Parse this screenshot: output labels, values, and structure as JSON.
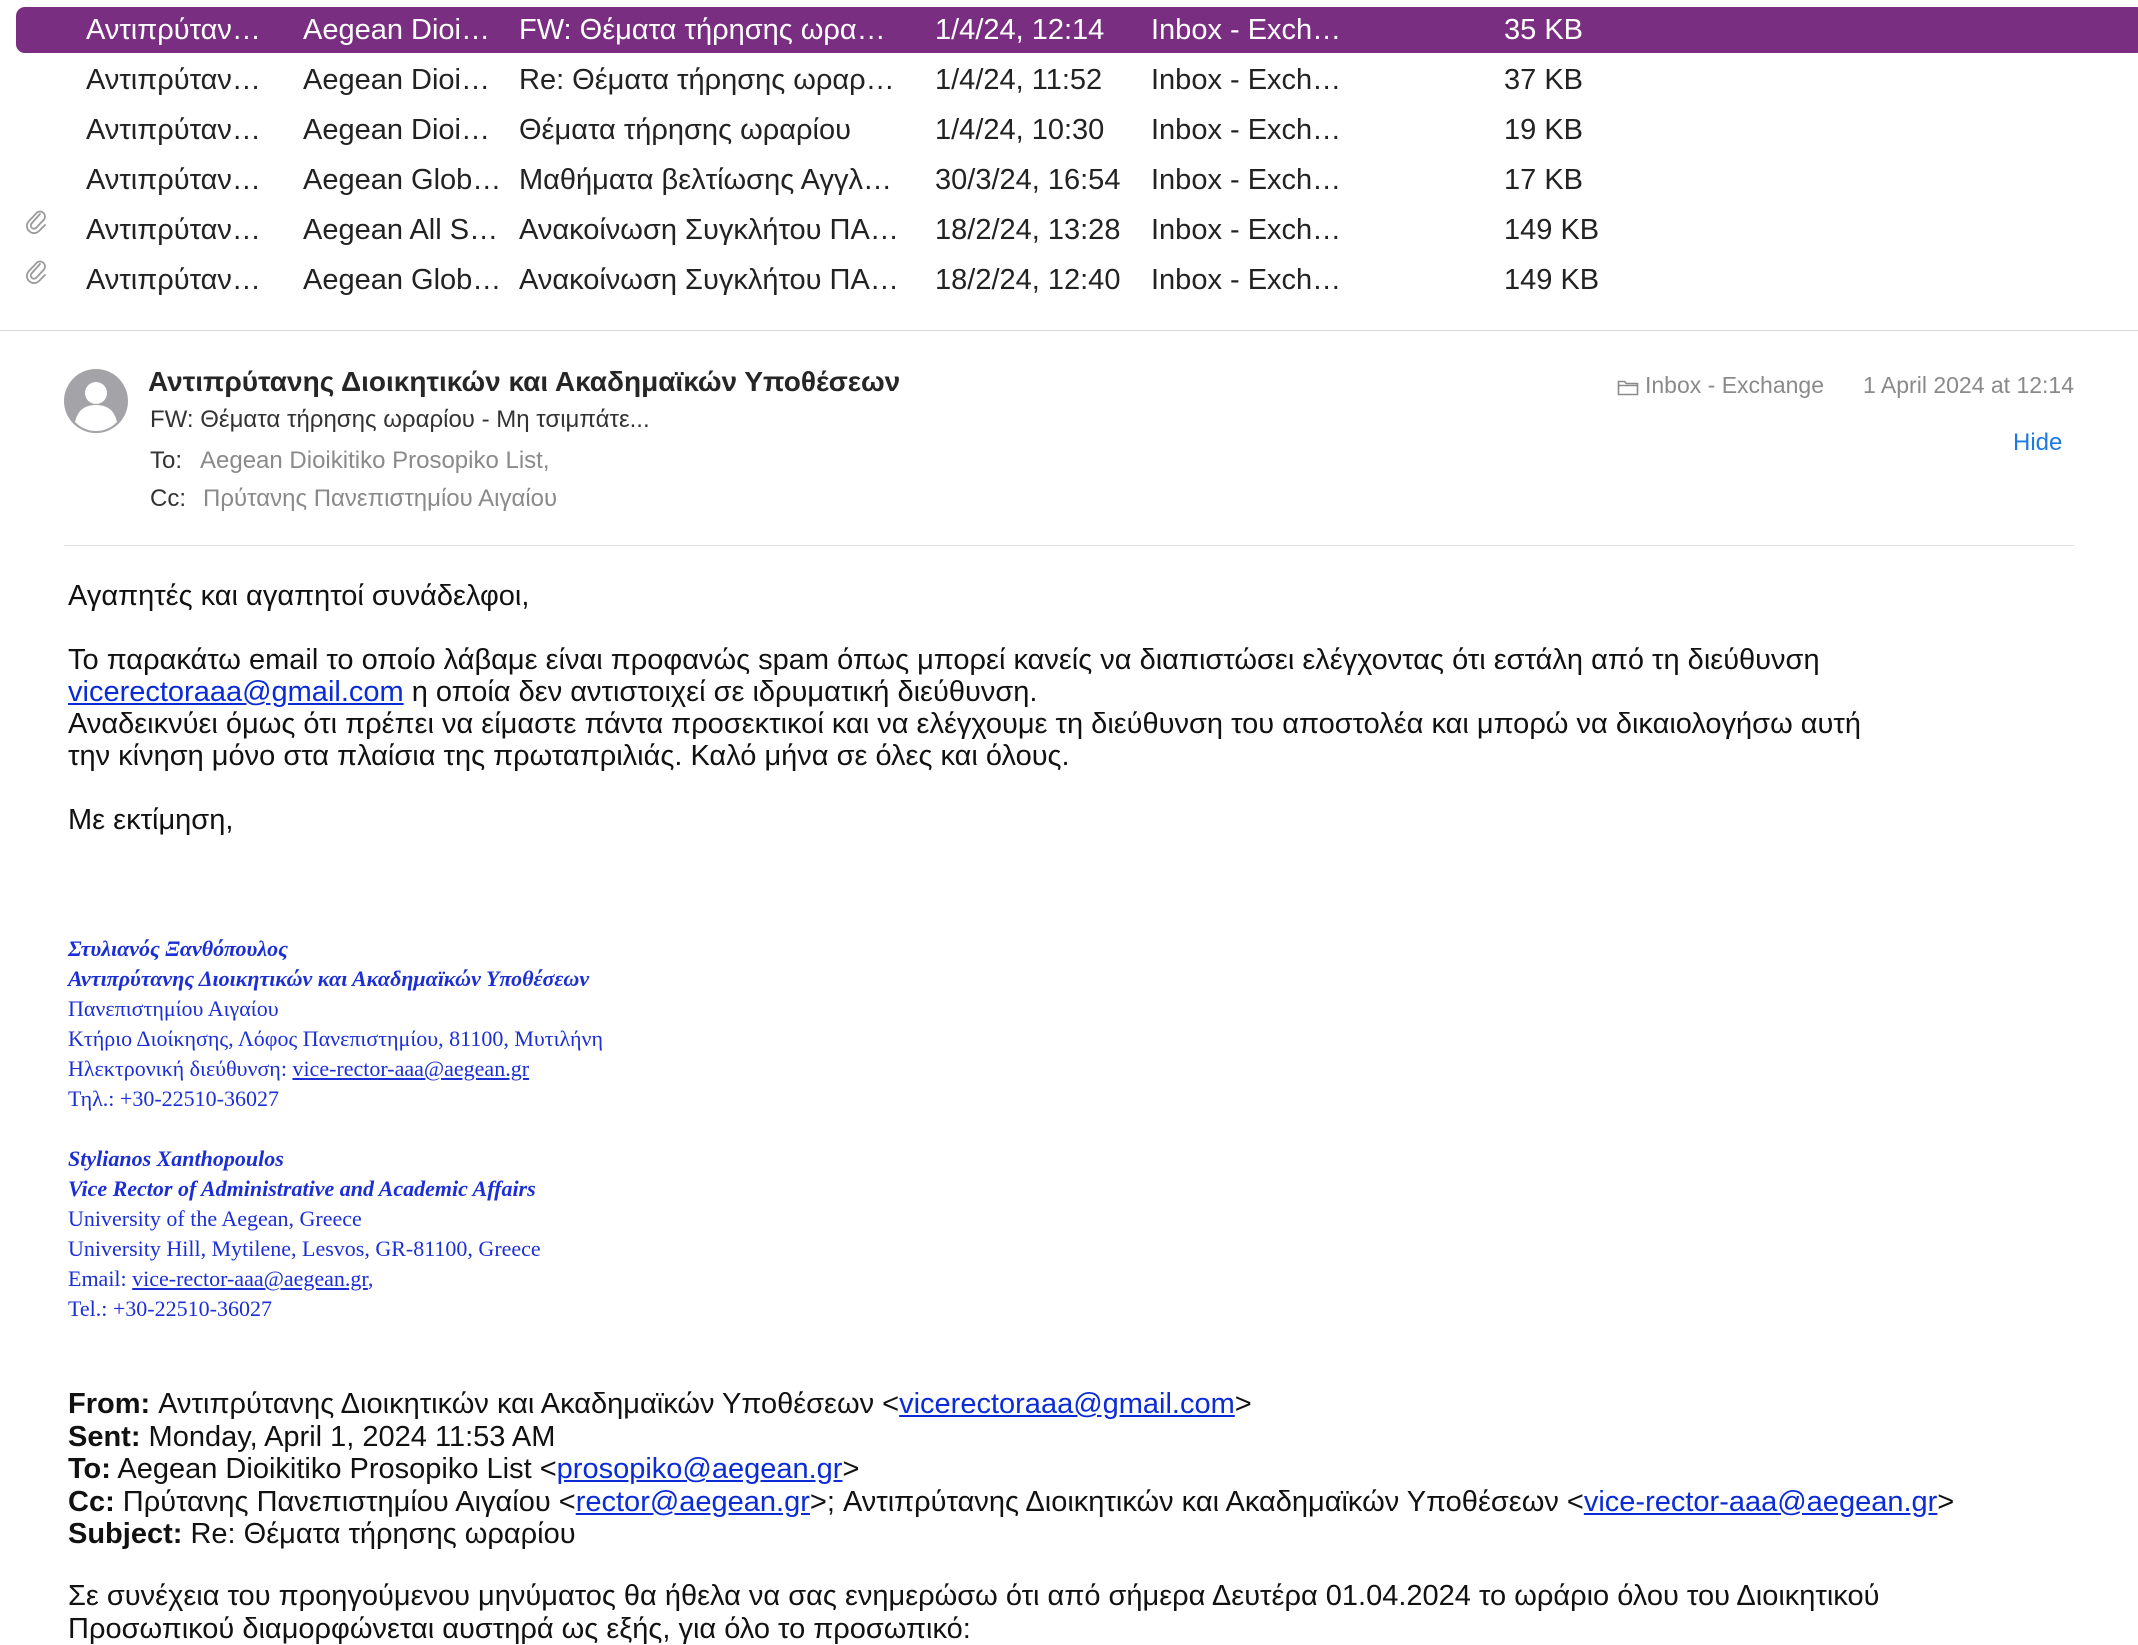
{
  "colors": {
    "selection": "#7a2e81",
    "link": "#0a2bd6",
    "signature": "#1b2fd4",
    "hide_link": "#1f7ae0"
  },
  "list": {
    "rows": [
      {
        "from": "Αντιπρύταν…",
        "to": "Aegean Dioi…",
        "subject": "FW: Θέματα τήρησης ωρα…",
        "date": "1/4/24, 12:14",
        "mailbox": "Inbox - Exch…",
        "size": "35 KB",
        "attachment": false,
        "selected": true
      },
      {
        "from": "Αντιπρύταν…",
        "to": "Aegean Dioi…",
        "subject": "Re: Θέματα τήρησης ωραρ…",
        "date": "1/4/24, 11:52",
        "mailbox": "Inbox - Exch…",
        "size": "37 KB",
        "attachment": false,
        "selected": false
      },
      {
        "from": "Αντιπρύταν…",
        "to": "Aegean Dioi…",
        "subject": "Θέματα τήρησης ωραρίου",
        "date": "1/4/24, 10:30",
        "mailbox": "Inbox - Exch…",
        "size": "19 KB",
        "attachment": false,
        "selected": false
      },
      {
        "from": "Αντιπρύταν…",
        "to": "Aegean Glob…",
        "subject": "Μαθήματα βελτίωσης Αγγλ…",
        "date": "30/3/24, 16:54",
        "mailbox": "Inbox - Exch…",
        "size": "17 KB",
        "attachment": false,
        "selected": false
      },
      {
        "from": "Αντιπρύταν…",
        "to": "Aegean All S…",
        "subject": "Ανακοίνωση Συγκλήτου ΠΑ…",
        "date": "18/2/24, 13:28",
        "mailbox": "Inbox - Exch…",
        "size": "149 KB",
        "attachment": true,
        "selected": false
      },
      {
        "from": "Αντιπρύταν…",
        "to": "Aegean Glob…",
        "subject": "Ανακοίνωση Συγκλήτου ΠΑ…",
        "date": "18/2/24, 12:40",
        "mailbox": "Inbox - Exch…",
        "size": "149 KB",
        "attachment": true,
        "selected": false
      }
    ]
  },
  "header": {
    "sender": "Αντιπρύτανης Διοικητικών και Ακαδημαϊκών Υποθέσεων",
    "subject": "FW: Θέματα τήρησης ωραρίου - Μη τσιμπάτε...",
    "to_label": "To:",
    "to_value": "Aegean Dioikitiko Prosopiko List,",
    "cc_label": "Cc:",
    "cc_value": "Πρύτανης Πανεπιστημίου Αιγαίου",
    "mailbox": "Inbox - Exchange",
    "date": "1 April 2024 at 12:14",
    "hide": "Hide"
  },
  "body": {
    "greeting": "Αγαπητές και αγαπητοί συνάδελφοι,",
    "p1_a": "Το παρακάτω email το οποίο λάβαμε είναι προφανώς spam όπως μπορεί κανείς να διαπιστώσει ελέγχοντας ότι εστάλη από τη διεύθυνση",
    "p1_link": "vicerectoraaa@gmail.com",
    "p1_b": " η οποία δεν αντιστοιχεί σε ιδρυματική διεύθυνση.",
    "p2_line1": "Αναδεικνύει όμως ότι πρέπει να είμαστε πάντα προσεκτικοί και να ελέγχουμε τη διεύθυνση του αποστολέα  και μπορώ να δικαιολογήσω αυτή",
    "p2_line2": "την κίνηση μόνο στα πλαίσια της πρωταπριλιάς. Καλό μήνα σε όλες και όλους.",
    "closing": "Με εκτίμηση,"
  },
  "signature": {
    "gr_name": "Στυλιανός Ξανθόπουλος",
    "gr_title": "Αντιπρύτανης Διοικητικών και Ακαδημαϊκών Υποθέσεων",
    "gr_univ": "Πανεπιστημίου Αιγαίου",
    "gr_address": "Κτήριο Διοίκησης, Λόφος Πανεπιστημίου, 81100, Μυτιλήνη",
    "gr_email_label": "Ηλεκτρονική διεύθυνση: ",
    "gr_email": "vice-rector-aaa@aegean.gr",
    "gr_phone": "Τηλ.: +30-22510-36027",
    "en_name": "Stylianos Xanthopoulos",
    "en_title": "Vice Rector of Administrative and Academic Affairs",
    "en_univ": "University of the Aegean, Greece",
    "en_address": "University Hill, Mytilene, Lesvos, GR-81100, Greece",
    "en_email_label": "Email: ",
    "en_email": "vice-rector-aaa@aegean.gr",
    "en_email_suffix": ",",
    "en_phone": "Tel.: +30-22510-36027"
  },
  "forwarded": {
    "from_label": "From:",
    "from_name": " Αντιπρύτανης Διοικητικών και Ακαδημαϊκών Υποθέσεων <",
    "from_email": "vicerectoraaa@gmail.com",
    "from_end": ">",
    "sent_label": "Sent:",
    "sent_value": " Monday, April 1, 2024 11:53 AM",
    "to_label": "To:",
    "to_name": " Aegean Dioikitiko Prosopiko List <",
    "to_email": "prosopiko@aegean.gr",
    "to_end": ">",
    "cc_label": "Cc:",
    "cc_name1": " Πρύτανης Πανεπιστημίου Αιγαίου <",
    "cc_email1": "rector@aegean.gr",
    "cc_mid": ">; Αντιπρύτανης Διοικητικών και Ακαδημαϊκών Υποθέσεων <",
    "cc_email2": "vice-rector-aaa@aegean.gr",
    "cc_end": ">",
    "subject_label": "Subject:",
    "subject_value": " Re: Θέματα τήρησης ωραρίου",
    "body_line1": "Σε συνέχεια του προηγούμενου μηνύματος θα ήθελα να σας ενημερώσω ότι από σήμερα Δευτέρα 01.04.2024 το ωράριο όλου του Διοικητικού",
    "body_line2": "Προσωπικού διαμορφώνεται αυστηρά ως εξής, για όλο το προσωπικό:"
  }
}
